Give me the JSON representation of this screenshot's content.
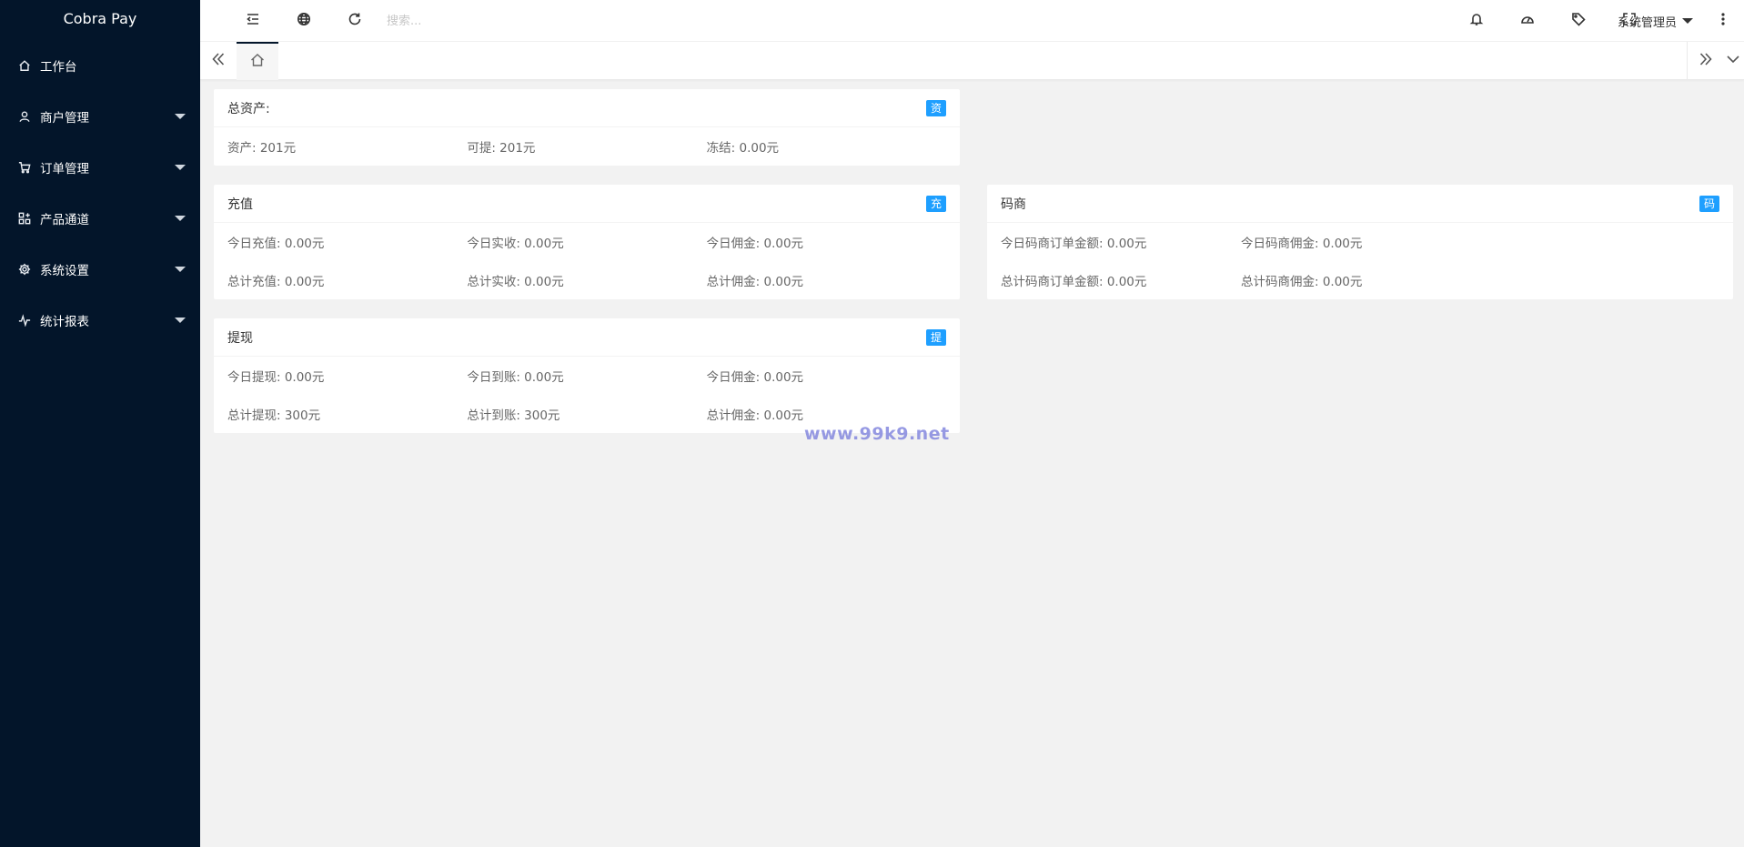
{
  "app": {
    "title": "Cobra Pay"
  },
  "sidebar": {
    "items": [
      {
        "label": "工作台",
        "icon": "home-icon",
        "has_submenu": false
      },
      {
        "label": "商户管理",
        "icon": "user-icon",
        "has_submenu": true
      },
      {
        "label": "订单管理",
        "icon": "cart-icon",
        "has_submenu": true
      },
      {
        "label": "产品通道",
        "icon": "apps-add-icon",
        "has_submenu": true
      },
      {
        "label": "系统设置",
        "icon": "gear-icon",
        "has_submenu": true
      },
      {
        "label": "统计报表",
        "icon": "pulse-icon",
        "has_submenu": true
      }
    ]
  },
  "header": {
    "search_placeholder": "搜索...",
    "icons": [
      "menu-collapse-icon",
      "globe-icon",
      "refresh-icon",
      "bell-icon",
      "dashboard-icon",
      "tag-icon",
      "fullscreen-icon",
      "more-vertical-icon"
    ],
    "user_name": "系统管理员"
  },
  "tabs": {
    "icons": [
      "double-chevron-left-icon",
      "home-icon",
      "double-chevron-right-icon",
      "chevron-down-icon"
    ]
  },
  "cards": {
    "assets": {
      "title": "总资产:",
      "badge": "资",
      "rows": [
        [
          "资产: 201元",
          "可提: 201元",
          "冻结: 0.00元"
        ]
      ]
    },
    "recharge": {
      "title": "充值",
      "badge": "充",
      "rows": [
        [
          "今日充值: 0.00元",
          "今日实收: 0.00元",
          "今日佣金: 0.00元"
        ],
        [
          "总计充值: 0.00元",
          "总计实收: 0.00元",
          "总计佣金: 0.00元"
        ]
      ]
    },
    "code_merchant": {
      "title": "码商",
      "badge": "码",
      "rows": [
        [
          "今日码商订单金额: 0.00元",
          "今日码商佣金: 0.00元"
        ],
        [
          "总计码商订单金额: 0.00元",
          "总计码商佣金: 0.00元"
        ]
      ]
    },
    "withdraw": {
      "title": "提现",
      "badge": "提",
      "rows": [
        [
          "今日提现: 0.00元",
          "今日到账: 0.00元",
          "今日佣金: 0.00元"
        ],
        [
          "总计提现: 300元",
          "总计到账: 300元",
          "总计佣金: 0.00元"
        ]
      ]
    }
  },
  "watermark": "www.99k9.net",
  "colors": {
    "sidebar_bg": "#03152a",
    "badge": "#1e9fff",
    "page_bg": "#f2f2f2"
  }
}
